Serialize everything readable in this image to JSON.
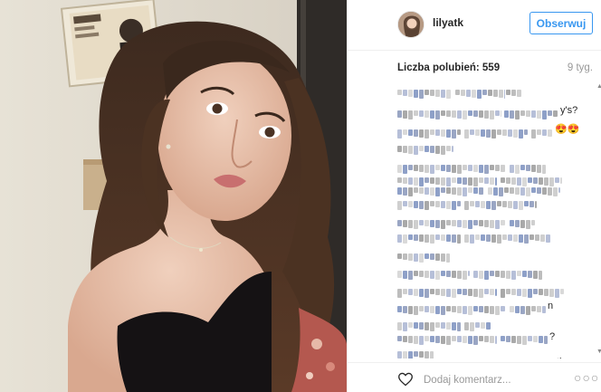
{
  "post": {
    "username": "lilyatk",
    "follow_label": "Obserwuj",
    "likes_label": "Liczba polubień: 559",
    "age": "9 tyg.",
    "comment_placeholder": "Dodaj komentarz...",
    "more_icon": "more-dots-icon",
    "like_icon": "heart-icon"
  },
  "comments": {
    "note": "",
    "lines": [
      {
        "tail": ""
      },
      {
        "tail": "y's? "
      },
      {
        "tail": "😍😍"
      },
      {
        "tail": ""
      },
      {
        "tail": ""
      },
      {
        "tail": ""
      },
      {
        "tail": ""
      },
      {
        "tail": ""
      },
      {
        "tail": ""
      },
      {
        "tail": ""
      },
      {
        "tail": ""
      },
      {
        "tail": ""
      },
      {
        "tail": ""
      },
      {
        "tail": "n"
      },
      {
        "tail": ""
      },
      {
        "tail": "?"
      },
      {
        "tail": ""
      },
      {
        "tail": "ther"
      },
      {
        "tail": ""
      }
    ]
  },
  "colors": {
    "link_blue": "#3897f0",
    "text": "#262626",
    "muted": "#999999",
    "border": "#efefef"
  }
}
